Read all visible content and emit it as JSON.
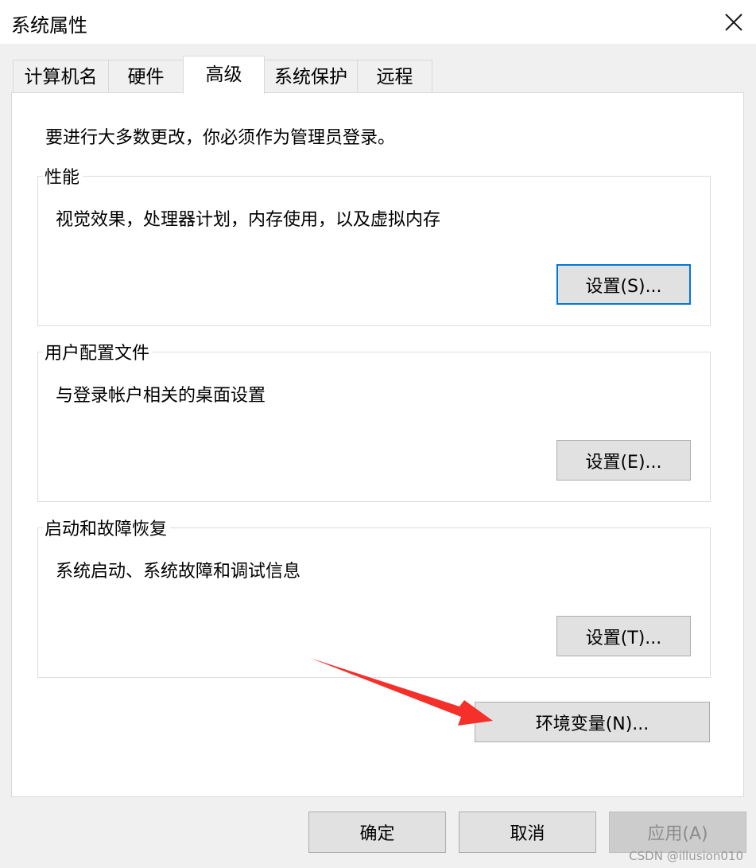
{
  "window": {
    "title": "系统属性",
    "close_icon": "close-icon"
  },
  "tabs": [
    {
      "label": "计算机名",
      "active": false
    },
    {
      "label": "硬件",
      "active": false
    },
    {
      "label": "高级",
      "active": true
    },
    {
      "label": "系统保护",
      "active": false
    },
    {
      "label": "远程",
      "active": false
    }
  ],
  "advanced": {
    "notice": "要进行大多数更改，你必须作为管理员登录。",
    "performance": {
      "title": "性能",
      "description": "视觉效果，处理器计划，内存使用，以及虚拟内存",
      "button": "设置(S)..."
    },
    "user_profiles": {
      "title": "用户配置文件",
      "description": "与登录帐户相关的桌面设置",
      "button": "设置(E)..."
    },
    "startup_recovery": {
      "title": "启动和故障恢复",
      "description": "系统启动、系统故障和调试信息",
      "button": "设置(T)..."
    },
    "env_vars_button": "环境变量(N)..."
  },
  "footer": {
    "ok": "确定",
    "cancel": "取消",
    "apply": "应用(A)"
  },
  "annotation": {
    "color": "#f5302a",
    "icon": "red-arrow-icon"
  },
  "watermark": "CSDN @illusion010"
}
